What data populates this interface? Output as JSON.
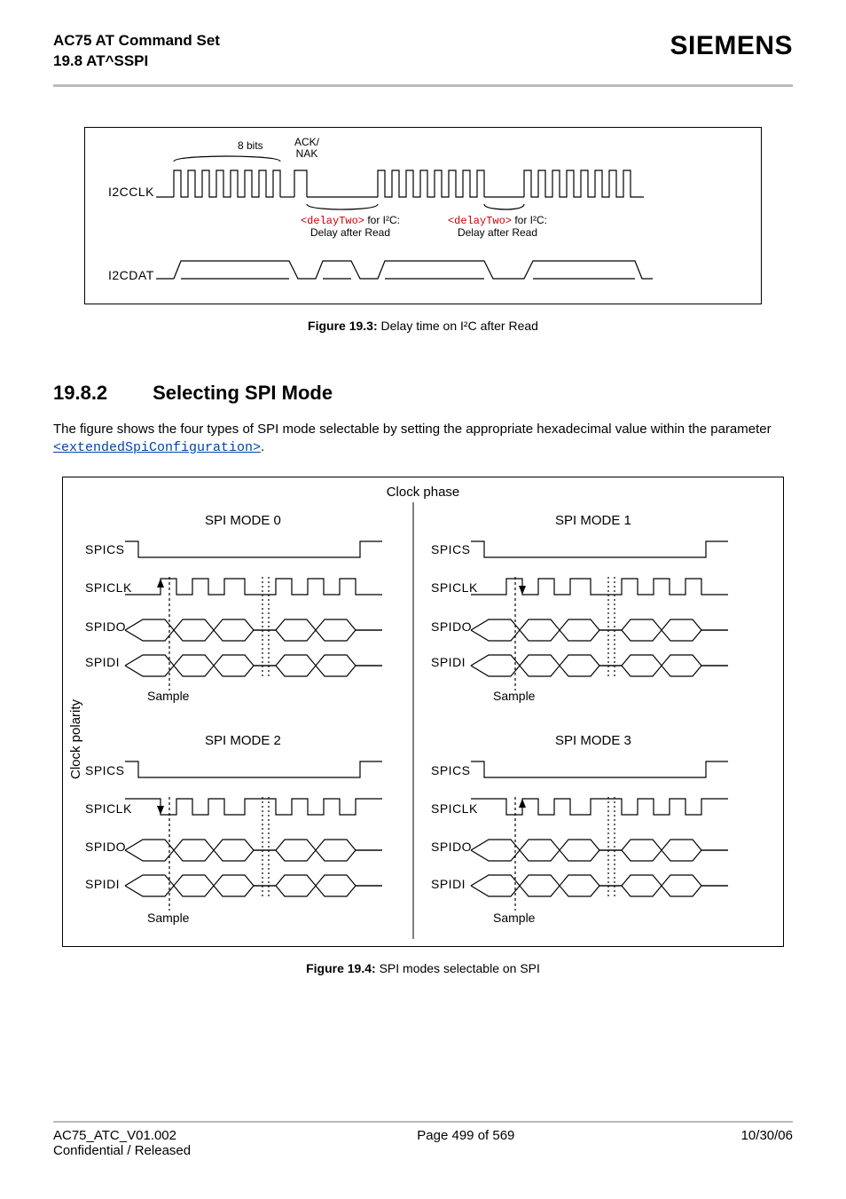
{
  "header": {
    "title_line1": "AC75 AT Command Set",
    "title_line2": "19.8 AT^SSPI",
    "brand": "SIEMENS"
  },
  "figure1": {
    "label_bits": "8 bits",
    "label_acknak_line1": "ACK/",
    "label_acknak_line2": "NAK",
    "signal_clk": "I2CCLK",
    "signal_dat": "I2CDAT",
    "delay_tag": "<delayTwo>",
    "delay_for": " for I²C:",
    "delay_sub": "Delay after Read",
    "caption_prefix": "Figure 19.3:",
    "caption_text": " Delay time on I²C after Read"
  },
  "section": {
    "number": "19.8.2",
    "title": "Selecting SPI Mode",
    "para_start": "The figure shows the four types of SPI mode selectable by setting the appropriate hexadecimal value within the parameter ",
    "param": "<extendedSpiConfiguration>",
    "para_end": "."
  },
  "figure2": {
    "clock_phase": "Clock phase",
    "clock_polarity": "Clock polarity",
    "modes": [
      "SPI MODE 0",
      "SPI MODE 1",
      "SPI MODE 2",
      "SPI MODE 3"
    ],
    "signals": [
      "SPICS",
      "SPICLK",
      "SPIDO",
      "SPIDI"
    ],
    "sample": "Sample",
    "caption_prefix": "Figure 19.4:",
    "caption_text": " SPI modes selectable on SPI"
  },
  "footer": {
    "left_line1": "AC75_ATC_V01.002",
    "left_line2": "Confidential / Released",
    "center": "Page 499 of 569",
    "right": "10/30/06"
  }
}
